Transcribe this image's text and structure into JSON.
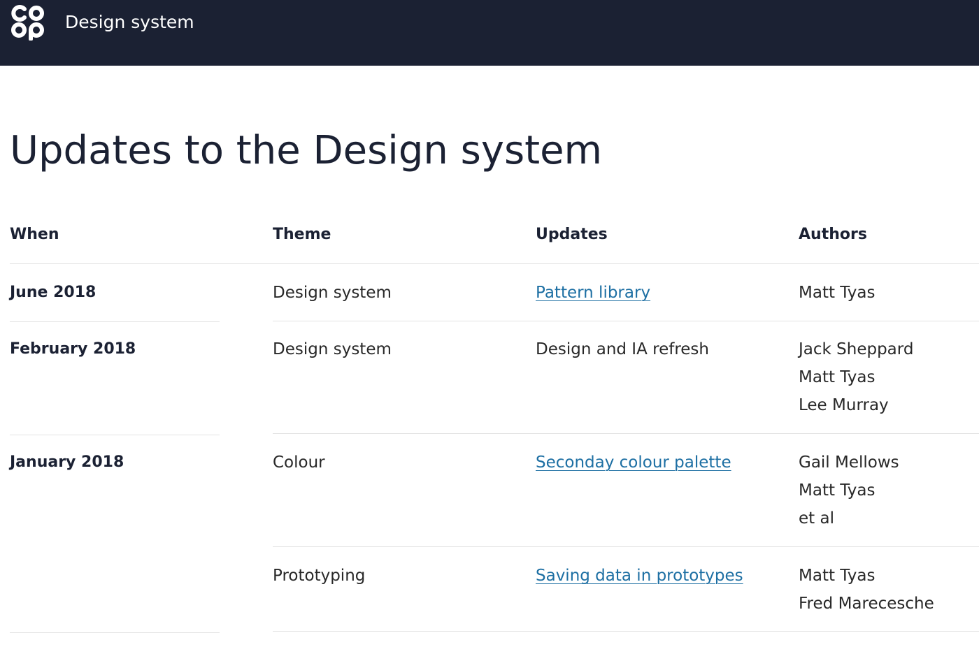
{
  "header": {
    "logo_text": "co op",
    "site_title": "Design system"
  },
  "page": {
    "title": "Updates to the Design system"
  },
  "table": {
    "columns": [
      "When",
      "Theme",
      "Updates",
      "Authors"
    ],
    "groups": [
      {
        "when": "June 2018",
        "rows": [
          {
            "theme": "Design system",
            "update": "Pattern library",
            "update_is_link": true,
            "authors": [
              "Matt Tyas"
            ]
          }
        ]
      },
      {
        "when": "February 2018",
        "rows": [
          {
            "theme": "Design system",
            "update": "Design and IA refresh",
            "update_is_link": false,
            "authors": [
              "Jack Sheppard",
              "Matt Tyas",
              "Lee Murray"
            ]
          }
        ]
      },
      {
        "when": "January 2018",
        "rows": [
          {
            "theme": "Colour",
            "update": "Seconday colour palette",
            "update_is_link": true,
            "authors": [
              "Gail Mellows",
              "Matt Tyas",
              "et al"
            ]
          },
          {
            "theme": "Prototyping",
            "update": "Saving data in prototypes",
            "update_is_link": true,
            "authors": [
              "Matt Tyas",
              "Fred Marecesche"
            ]
          }
        ]
      }
    ]
  },
  "colors": {
    "header_bg": "#1b2133",
    "link": "#1d6fa3",
    "text": "#282828",
    "rule": "#e3e3e3"
  }
}
